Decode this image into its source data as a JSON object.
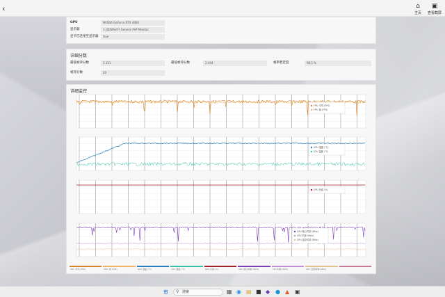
{
  "topbar": {
    "home_label": "主页",
    "screenshot_label": "查看截屏"
  },
  "hardware": {
    "rows": [
      {
        "label": "GPU",
        "value": "NVIDIA GeForce RTX 4060"
      },
      {
        "label": "显示器",
        "value": "1.(SDSPull?) Generic PnP Monitor"
      },
      {
        "label": "显卡已连接至显示器",
        "value": "true"
      }
    ]
  },
  "details": {
    "title": "详细分数",
    "rows": [
      {
        "label": "最低帧评分数",
        "value": "2.151"
      },
      {
        "label": "最低帧评分数",
        "value": "2.494"
      },
      {
        "label": "帧率稳定度",
        "value": "98.5 %"
      },
      {
        "label": "帧评分数",
        "value": "20"
      }
    ]
  },
  "monitor": {
    "title": "详细监控",
    "chart1_legend": [
      "FPS: 平均 (FPS)",
      "FPS: 帧 (FPS)"
    ],
    "chart2_legend": [
      "GPU 温度 (°C)",
      "CPU 温度 (°C)"
    ],
    "chart3_legend": [
      "GPU 负载 (%)"
    ],
    "chart4_legend": [
      "GPU 核心时钟 (MHz)",
      "CPU 时钟 (MHz)",
      "GPU 显存时钟 (MHz)"
    ]
  },
  "legend_colors": [
    "#d98324",
    "#f0b35f",
    "#2a7fc0",
    "#35c4a8",
    "#a21e2b",
    "#7b3fb8",
    "#c18fd8",
    "#e0c290",
    "#c77a95"
  ],
  "taskbar": {
    "search_placeholder": "搜索"
  }
}
